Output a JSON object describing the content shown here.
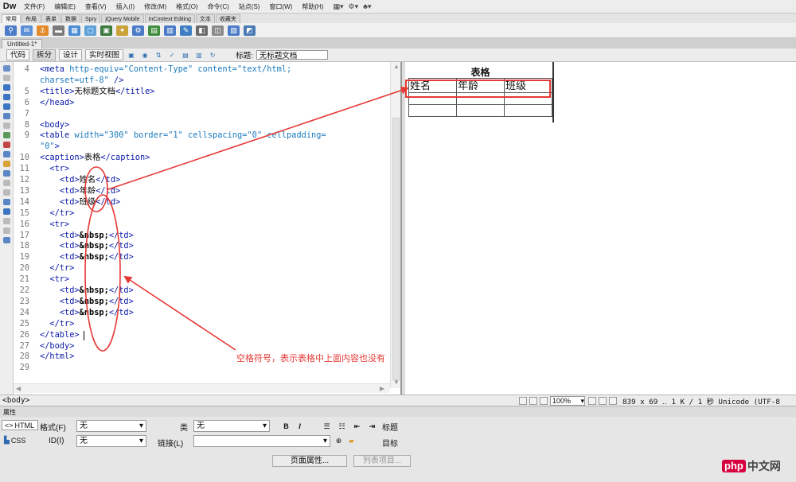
{
  "app": {
    "logo": "Dw"
  },
  "menubar": {
    "items": [
      "文件(F)",
      "编辑(E)",
      "查看(V)",
      "插入(I)",
      "修改(M)",
      "格式(O)",
      "命令(C)",
      "站点(S)",
      "窗口(W)",
      "帮助(H)"
    ],
    "drops": [
      "▦▾",
      "⚙▾",
      "♣▾"
    ]
  },
  "insert_bar": {
    "tabs": [
      "常用",
      "布局",
      "表单",
      "数据",
      "Spry",
      "jQuery Mobile",
      "InContext Editing",
      "文本",
      "收藏夹"
    ],
    "active_tab": "常用"
  },
  "doc_tab": {
    "label": "Untitled-1*"
  },
  "doc_toolbar": {
    "views": [
      "代码",
      "拆分",
      "设计",
      "实时视图"
    ],
    "active_view": "拆分",
    "title_label": "标题:",
    "title_value": "无标题文档"
  },
  "code": {
    "lines": [
      {
        "n": "4",
        "html": "<span class=\"tg\">&lt;meta</span> <span class=\"at\">http-equiv=</span><span class=\"st\">\"Content-Type\"</span> <span class=\"at\">content=</span><span class=\"st\">\"text/html;</span>"
      },
      {
        "n": "",
        "html": "<span class=\"st\">charset=utf-8\"</span> <span class=\"tg\">/&gt;</span>"
      },
      {
        "n": "5",
        "html": "<span class=\"tg\">&lt;title&gt;</span><span class=\"tx\">无标题文档</span><span class=\"tg\">&lt;/title&gt;</span>"
      },
      {
        "n": "6",
        "html": "<span class=\"tg\">&lt;/head&gt;</span>"
      },
      {
        "n": "7",
        "html": ""
      },
      {
        "n": "8",
        "html": "<span class=\"tg\">&lt;body&gt;</span>"
      },
      {
        "n": "9",
        "html": "<span class=\"tg\">&lt;table</span> <span class=\"at\">width=</span><span class=\"st\">\"300\"</span> <span class=\"at\">border=</span><span class=\"st\">\"1\"</span> <span class=\"at\">cellspacing=</span><span class=\"st\">\"0\"</span> <span class=\"at\">cellpadding=</span>"
      },
      {
        "n": "",
        "html": "<span class=\"st\">\"0\"</span><span class=\"tg\">&gt;</span>"
      },
      {
        "n": "10",
        "html": "<span class=\"tg\">&lt;caption&gt;</span><span class=\"tx\">表格</span><span class=\"tg\">&lt;/caption&gt;</span>"
      },
      {
        "n": "11",
        "html": "  <span class=\"tg\">&lt;tr&gt;</span>"
      },
      {
        "n": "12",
        "html": "    <span class=\"tg\">&lt;td&gt;</span><span class=\"tx\">姓名</span><span class=\"tg\">&lt;/td&gt;</span>"
      },
      {
        "n": "13",
        "html": "    <span class=\"tg\">&lt;td&gt;</span><span class=\"tx\">年龄</span><span class=\"tg\">&lt;/td&gt;</span>"
      },
      {
        "n": "14",
        "html": "    <span class=\"tg\">&lt;td&gt;</span><span class=\"tx\">班级</span><span class=\"tg\">&lt;/td&gt;</span>"
      },
      {
        "n": "15",
        "html": "  <span class=\"tg\">&lt;/tr&gt;</span>"
      },
      {
        "n": "16",
        "html": "  <span class=\"tg\">&lt;tr&gt;</span>"
      },
      {
        "n": "17",
        "html": "    <span class=\"tg\">&lt;td&gt;</span><span class=\"en\">&amp;nbsp;</span><span class=\"tg\">&lt;/td&gt;</span>"
      },
      {
        "n": "18",
        "html": "    <span class=\"tg\">&lt;td&gt;</span><span class=\"en\">&amp;nbsp;</span><span class=\"tg\">&lt;/td&gt;</span>"
      },
      {
        "n": "19",
        "html": "    <span class=\"tg\">&lt;td&gt;</span><span class=\"en\">&amp;nbsp;</span><span class=\"tg\">&lt;/td&gt;</span>"
      },
      {
        "n": "20",
        "html": "  <span class=\"tg\">&lt;/tr&gt;</span>"
      },
      {
        "n": "21",
        "html": "  <span class=\"tg\">&lt;tr&gt;</span>"
      },
      {
        "n": "22",
        "html": "    <span class=\"tg\">&lt;td&gt;</span><span class=\"en\">&amp;nbsp;</span><span class=\"tg\">&lt;/td&gt;</span>"
      },
      {
        "n": "23",
        "html": "    <span class=\"tg\">&lt;td&gt;</span><span class=\"en\">&amp;nbsp;</span><span class=\"tg\">&lt;/td&gt;</span>"
      },
      {
        "n": "24",
        "html": "    <span class=\"tg\">&lt;td&gt;</span><span class=\"en\">&amp;nbsp;</span><span class=\"tg\">&lt;/td&gt;</span>"
      },
      {
        "n": "25",
        "html": "  <span class=\"tg\">&lt;/tr&gt;</span>"
      },
      {
        "n": "26",
        "html": "<span class=\"tg\">&lt;/table&gt;</span>"
      },
      {
        "n": "27",
        "html": "<span class=\"tg\">&lt;/body&gt;</span>"
      },
      {
        "n": "28",
        "html": "<span class=\"tg\">&lt;/html&gt;</span>"
      },
      {
        "n": "29",
        "html": ""
      }
    ]
  },
  "preview": {
    "caption": "表格",
    "rows": [
      [
        "姓名",
        "年龄",
        "班级"
      ],
      [
        "",
        "",
        ""
      ],
      [
        "",
        "",
        ""
      ]
    ]
  },
  "annotation": {
    "text": "空格符号，表示表格中上面内容也没有",
    "color": "#e53935"
  },
  "status": {
    "tag_selector": "<body>",
    "zoom": "100%",
    "info": "839 x 69 ‥ 1 K / 1 秒 Unicode (UTF-8"
  },
  "properties": {
    "header": "属性",
    "modes": {
      "html": "HTML",
      "css": "CSS"
    },
    "format_label": "格式(F)",
    "format_value": "无",
    "id_label": "ID(I)",
    "id_value": "无",
    "class_label": "类",
    "class_value": "无",
    "link_label": "链接(L)",
    "link_value": "",
    "bold": "B",
    "italic": "I",
    "title_label": "标题",
    "target_label": "目标",
    "page_props_button": "页面属性...",
    "list_item_button": "列表项目..."
  },
  "watermark": {
    "php": "php",
    "cn": "中文网"
  }
}
